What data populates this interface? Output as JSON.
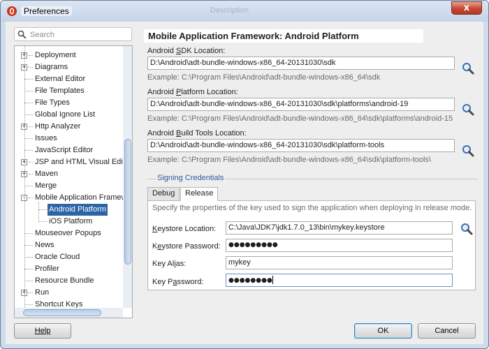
{
  "window": {
    "title": "Preferences",
    "close_glyph": "x",
    "background_ghost_text": "Description"
  },
  "search": {
    "placeholder": "Search",
    "value": ""
  },
  "tree": {
    "items": [
      {
        "label": "Deployment",
        "expandable": true
      },
      {
        "label": "Diagrams",
        "expandable": true
      },
      {
        "label": "External Editor",
        "expandable": false
      },
      {
        "label": "File Templates",
        "expandable": false
      },
      {
        "label": "File Types",
        "expandable": false
      },
      {
        "label": "Global Ignore List",
        "expandable": false
      },
      {
        "label": "Http Analyzer",
        "expandable": true
      },
      {
        "label": "Issues",
        "expandable": false
      },
      {
        "label": "JavaScript Editor",
        "expandable": false
      },
      {
        "label": "JSP and HTML Visual Editor",
        "expandable": true
      },
      {
        "label": "Maven",
        "expandable": true
      },
      {
        "label": "Merge",
        "expandable": false
      },
      {
        "label": "Mobile Application Framework",
        "expandable": true,
        "expanded": true
      },
      {
        "label": "Android Platform",
        "child": true,
        "selected": true
      },
      {
        "label": "iOS Platform",
        "child": true
      },
      {
        "label": "Mouseover Popups",
        "expandable": false
      },
      {
        "label": "News",
        "expandable": false
      },
      {
        "label": "Oracle Cloud",
        "expandable": false
      },
      {
        "label": "Profiler",
        "expandable": false
      },
      {
        "label": "Resource Bundle",
        "expandable": false
      },
      {
        "label": "Run",
        "expandable": true
      },
      {
        "label": "Shortcut Keys",
        "expandable": false
      }
    ]
  },
  "main": {
    "section_title": "Mobile Application Framework: Android Platform",
    "sdk": {
      "label_pre": "Android ",
      "label_mnemonic": "S",
      "label_post": "DK Location:",
      "value": "D:\\Android\\adt-bundle-windows-x86_64-20131030\\sdk",
      "example": "Example: C:\\Program Files\\Android\\adt-bundle-windows-x86_64\\sdk"
    },
    "platform": {
      "label_pre": "Android ",
      "label_mnemonic": "P",
      "label_post": "latform Location:",
      "value": "D:\\Android\\adt-bundle-windows-x86_64-20131030\\sdk\\platforms\\android-19",
      "example": "Example: C:\\Program Files\\Android\\adt-bundle-windows-x86_64\\sdk\\platforms\\android-15"
    },
    "build_tools": {
      "label_pre": "Android ",
      "label_mnemonic": "B",
      "label_post": "uild Tools Location:",
      "value": "D:\\Android\\adt-bundle-windows-x86_64-20131030\\sdk\\platform-tools",
      "example": "Example: C:\\Program Files\\Android\\adt-bundle-windows-x86_64\\sdk\\platform-tools\\"
    },
    "signing": {
      "group_label": "Signing Credentials",
      "tabs": [
        {
          "label": "Debug",
          "active": false
        },
        {
          "label": "Release",
          "active": true
        }
      ],
      "description": "Specify the properties of the key used to sign the application when deploying in release mode.",
      "keystore_location": {
        "label_mnemonic": "K",
        "label_post": "eystore Location:",
        "value": "C:\\Java\\JDK7\\jdk1.7.0_13\\bin\\mykey.keystore"
      },
      "keystore_password": {
        "label_pre": "K",
        "label_mnemonic": "e",
        "label_post": "ystore Password:",
        "value": "●●●●●●●●●"
      },
      "key_alias": {
        "label_pre": "Key Al",
        "label_mnemonic": "i",
        "label_post": "as:",
        "value": "mykey"
      },
      "key_password": {
        "label_pre": "Key P",
        "label_mnemonic": "a",
        "label_post": "ssword:",
        "value": "●●●●●●●●"
      }
    }
  },
  "buttons": {
    "help": "Help",
    "ok": "OK",
    "cancel": "Cancel"
  },
  "colors": {
    "selection": "#2c65a6",
    "accent_link": "#2c5aa0",
    "close_button": "#c8452f"
  },
  "icons": {
    "app": "oracle-jdev-icon",
    "search": "magnifier-icon",
    "browse": "magnifier-browse-icon",
    "close": "close-icon"
  }
}
